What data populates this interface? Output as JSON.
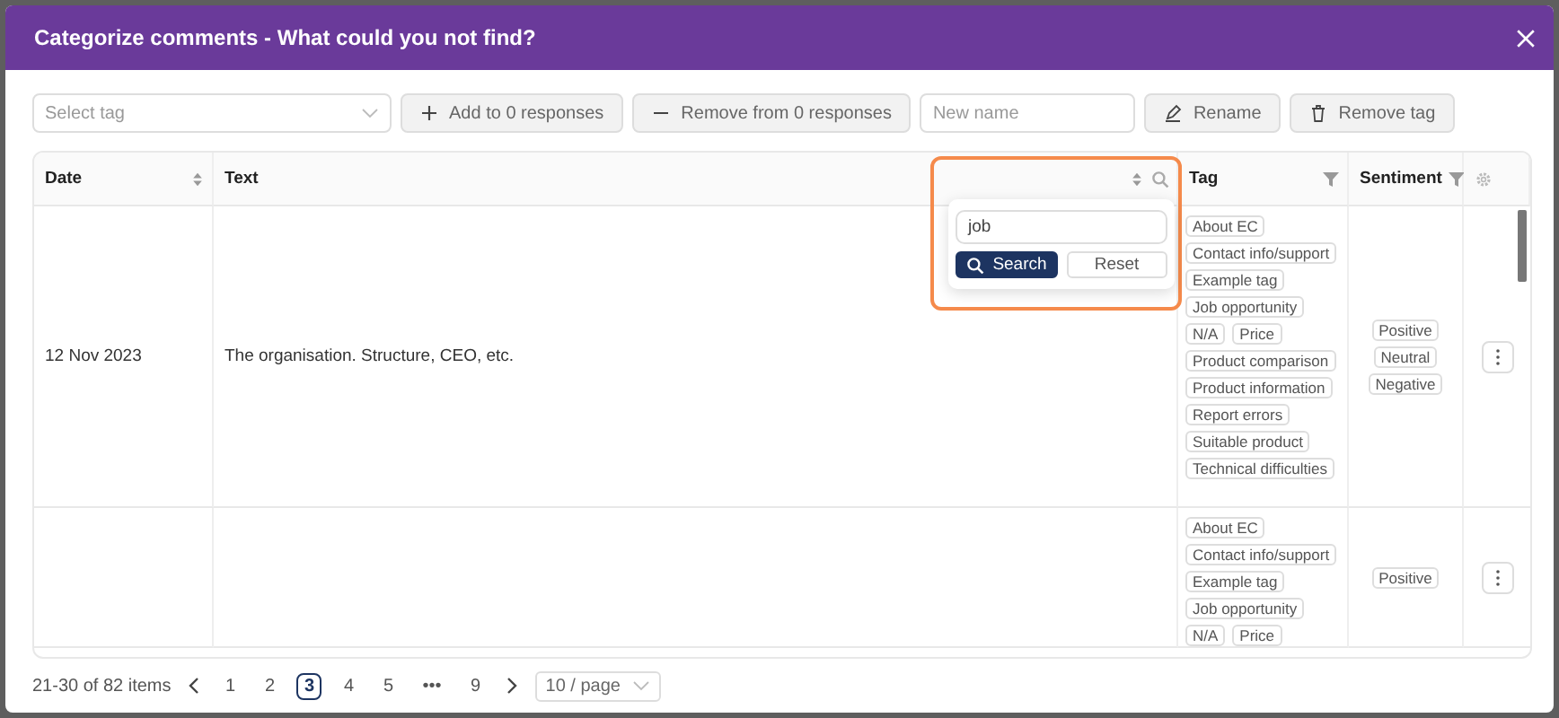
{
  "window": {
    "title": "Categorize comments - What could you not find?"
  },
  "toolbar": {
    "tag_select": {
      "placeholder": "Select tag"
    },
    "name_field": {
      "placeholder": "New name"
    },
    "buttons": [
      {
        "label": "Add to 0 responses",
        "kind": "add"
      },
      {
        "label": "Remove from 0 responses",
        "kind": "remove"
      },
      {
        "label": "Rename",
        "kind": "rename"
      },
      {
        "label": "Remove tag",
        "kind": "delete"
      }
    ]
  },
  "table": {
    "columns": [
      {
        "label": "Date",
        "kind": "sort"
      },
      {
        "label": "Text",
        "kind": "sort-search"
      },
      {
        "label": "Tag",
        "kind": "filter"
      },
      {
        "label": "Sentiment",
        "kind": "filter"
      }
    ],
    "rows": [
      {
        "date": "12 Nov 2023",
        "text": "The organisation. Structure, CEO, etc.",
        "tags": [
          "About EC",
          "Contact info/support",
          "Example tag",
          "Job opportunity",
          "N/A",
          "Price",
          "Product comparison",
          "Product information",
          "Report errors",
          "Suitable product",
          "Technical difficulties"
        ],
        "sentiments": [
          "Positive",
          "Neutral",
          "Negative"
        ]
      },
      {
        "tags": [
          "About EC",
          "Contact info/support",
          "Example tag",
          "Job opportunity",
          "N/A",
          "Price"
        ],
        "sentiments": [
          "Positive"
        ]
      }
    ]
  },
  "search_popup": {
    "value": "job",
    "buttons": [
      {
        "label": "Search",
        "kind": "primary"
      },
      {
        "label": "Reset",
        "kind": "default"
      }
    ]
  },
  "pagination": {
    "summary": "21-30 of 82 items",
    "pages": [
      {
        "label": "1",
        "selected": false
      },
      {
        "label": "2",
        "selected": false
      },
      {
        "label": "3",
        "selected": true
      },
      {
        "label": "4",
        "selected": false
      },
      {
        "label": "5",
        "selected": false
      },
      {
        "label": "•••",
        "selected": false
      },
      {
        "label": "9",
        "selected": false
      }
    ],
    "page_size": "10 / page"
  }
}
